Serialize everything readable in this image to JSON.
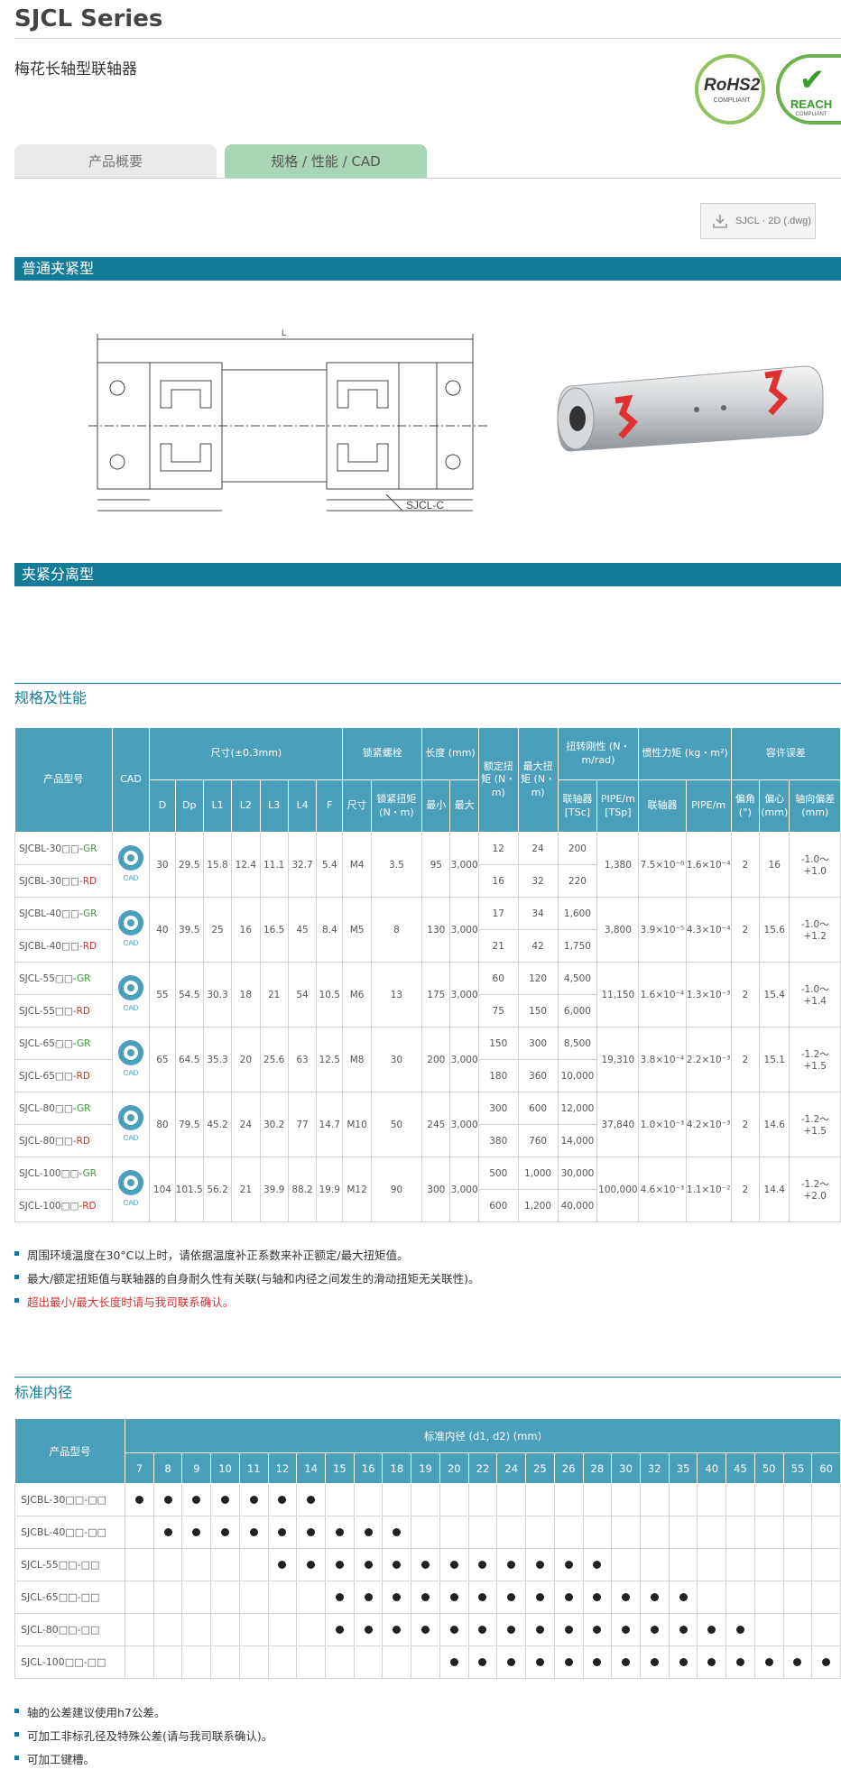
{
  "header": {
    "title": "SJCL Series",
    "subtitle": "梅花长轴型联轴器",
    "badges": {
      "rohs": {
        "main": "RoHS2",
        "sub": "COMPLIANT"
      },
      "reach": {
        "main": "REACH",
        "sub": "COMPLIANT"
      }
    }
  },
  "tabs": [
    {
      "label": "产品概要",
      "active": false
    },
    {
      "label": "规格 / 性能 / CAD",
      "active": true
    }
  ],
  "download": {
    "label": "SJCL · 2D (.dwg)"
  },
  "sections": {
    "clamp": "普通夹紧型",
    "split": "夹紧分离型",
    "spec_title": "规格及性能",
    "bore_title": "标准内径"
  },
  "drawing": {
    "model_label": "SJCL-C"
  },
  "spec_table": {
    "headers": {
      "model": "产品型号",
      "cad": "CAD",
      "dims": "尺寸(±0.3mm)",
      "bolt": "锁紧螺栓",
      "length": "长度 (mm)",
      "rated": "额定扭矩 (N・m)",
      "max_torque": "最大扭矩 (N・m)",
      "stiffness": "扭转刚性 (N・m/rad)",
      "inertia": "惯性力矩 (kg・m²)",
      "tolerance": "容许误差",
      "D": "D",
      "Dp": "Dp",
      "L1": "L1",
      "L2": "L2",
      "L3": "L3",
      "L4": "L4",
      "F": "F",
      "bolt_size": "尺寸",
      "bolt_torque": "锁紧扭矩 (N・m)",
      "len_min": "最小",
      "len_max": "最大",
      "stiff_coupling": "联轴器 [TSc]",
      "stiff_pipe": "PIPE/m [TSp]",
      "inertia_coupling": "联轴器",
      "inertia_pipe": "PIPE/m",
      "angle": "偏角 (°)",
      "offset": "偏心 (mm)",
      "axial": "轴向偏差 (mm)"
    },
    "rows": [
      {
        "m1": "SJCBL-30□□-GR",
        "m2": "SJCBL-30□□-RD",
        "D": "30",
        "Dp": "29.5",
        "L1": "15.8",
        "L2": "12.4",
        "L3": "11.1",
        "L4": "32.7",
        "F": "5.4",
        "bolt": "M4",
        "bt": "3.5",
        "lmin": "95",
        "lmax": "3,000",
        "r1": "12",
        "r2": "16",
        "x1": "24",
        "x2": "32",
        "s1": "200",
        "s2": "220",
        "sp": "1,380",
        "ic": "7.5×10⁻⁶",
        "ip": "1.6×10⁻⁴",
        "ang": "2",
        "off": "16",
        "ax": "-1.0～+1.0"
      },
      {
        "m1": "SJCBL-40□□-GR",
        "m2": "SJCBL-40□□-RD",
        "D": "40",
        "Dp": "39.5",
        "L1": "25",
        "L2": "16",
        "L3": "16.5",
        "L4": "45",
        "F": "8.4",
        "bolt": "M5",
        "bt": "8",
        "lmin": "130",
        "lmax": "3,000",
        "r1": "17",
        "r2": "21",
        "x1": "34",
        "x2": "42",
        "s1": "1,600",
        "s2": "1,750",
        "sp": "3,800",
        "ic": "3.9×10⁻⁵",
        "ip": "4.3×10⁻⁴",
        "ang": "2",
        "off": "15.6",
        "ax": "-1.0～+1.2"
      },
      {
        "m1": "SJCL-55□□-GR",
        "m2": "SJCL-55□□-RD",
        "D": "55",
        "Dp": "54.5",
        "L1": "30.3",
        "L2": "18",
        "L3": "21",
        "L4": "54",
        "F": "10.5",
        "bolt": "M6",
        "bt": "13",
        "lmin": "175",
        "lmax": "3,000",
        "r1": "60",
        "r2": "75",
        "x1": "120",
        "x2": "150",
        "s1": "4,500",
        "s2": "6,000",
        "sp": "11,150",
        "ic": "1.6×10⁻⁴",
        "ip": "1.3×10⁻³",
        "ang": "2",
        "off": "15.4",
        "ax": "-1.0～+1.4"
      },
      {
        "m1": "SJCL-65□□-GR",
        "m2": "SJCL-65□□-RD",
        "D": "65",
        "Dp": "64.5",
        "L1": "35.3",
        "L2": "20",
        "L3": "25.6",
        "L4": "63",
        "F": "12.5",
        "bolt": "M8",
        "bt": "30",
        "lmin": "200",
        "lmax": "3,000",
        "r1": "150",
        "r2": "180",
        "x1": "300",
        "x2": "360",
        "s1": "8,500",
        "s2": "10,000",
        "sp": "19,310",
        "ic": "3.8×10⁻⁴",
        "ip": "2.2×10⁻³",
        "ang": "2",
        "off": "15.1",
        "ax": "-1.2～+1.5"
      },
      {
        "m1": "SJCL-80□□-GR",
        "m2": "SJCL-80□□-RD",
        "D": "80",
        "Dp": "79.5",
        "L1": "45.2",
        "L2": "24",
        "L3": "30.2",
        "L4": "77",
        "F": "14.7",
        "bolt": "M10",
        "bt": "50",
        "lmin": "245",
        "lmax": "3,000",
        "r1": "300",
        "r2": "380",
        "x1": "600",
        "x2": "760",
        "s1": "12,000",
        "s2": "14,000",
        "sp": "37,840",
        "ic": "1.0×10⁻³",
        "ip": "4.2×10⁻³",
        "ang": "2",
        "off": "14.6",
        "ax": "-1.2～+1.5"
      },
      {
        "m1": "SJCL-100□□-GR",
        "m2": "SJCL-100□□-RD",
        "D": "104",
        "Dp": "101.5",
        "L1": "56.2",
        "L2": "21",
        "L3": "39.9",
        "L4": "88.2",
        "F": "19.9",
        "bolt": "M12",
        "bt": "90",
        "lmin": "300",
        "lmax": "3,000",
        "r1": "500",
        "r2": "600",
        "x1": "1,000",
        "x2": "1,200",
        "s1": "30,000",
        "s2": "40,000",
        "sp": "100,000",
        "ic": "4.6×10⁻³",
        "ip": "1.1×10⁻²",
        "ang": "2",
        "off": "14.4",
        "ax": "-1.2～+2.0"
      }
    ]
  },
  "notes1": [
    {
      "text": "周围环境温度在30°C以上时，请依据温度补正系数来补正额定/最大扭矩值。",
      "red": false
    },
    {
      "text": "最大/额定扭矩值与联轴器的自身耐久性有关联(与轴和内径之间发生的滑动扭矩无关联性)。",
      "red": false
    },
    {
      "text": "超出最小/最大长度时请与我司联系确认。",
      "red": true
    }
  ],
  "bore_table": {
    "model_header": "产品型号",
    "group_header": "标准内径 (d1, d2) (mm)",
    "sizes": [
      "7",
      "8",
      "9",
      "10",
      "11",
      "12",
      "14",
      "15",
      "16",
      "18",
      "19",
      "20",
      "22",
      "24",
      "25",
      "26",
      "28",
      "30",
      "32",
      "35",
      "40",
      "45",
      "50",
      "55",
      "60"
    ],
    "rows": [
      {
        "model": "SJCBL-30□□-□□",
        "avail": [
          "7",
          "8",
          "9",
          "10",
          "11",
          "12",
          "14"
        ]
      },
      {
        "model": "SJCBL-40□□-□□",
        "avail": [
          "8",
          "9",
          "10",
          "11",
          "12",
          "14",
          "15",
          "16",
          "18"
        ]
      },
      {
        "model": "SJCL-55□□-□□",
        "avail": [
          "12",
          "14",
          "15",
          "16",
          "18",
          "19",
          "20",
          "22",
          "24",
          "25",
          "26",
          "28"
        ]
      },
      {
        "model": "SJCL-65□□-□□",
        "avail": [
          "15",
          "16",
          "18",
          "19",
          "20",
          "22",
          "24",
          "25",
          "26",
          "28",
          "30",
          "32",
          "35"
        ]
      },
      {
        "model": "SJCL-80□□-□□",
        "avail": [
          "15",
          "16",
          "18",
          "19",
          "20",
          "22",
          "24",
          "25",
          "26",
          "28",
          "30",
          "32",
          "35",
          "40",
          "45"
        ]
      },
      {
        "model": "SJCL-100□□-□□",
        "avail": [
          "20",
          "22",
          "24",
          "25",
          "26",
          "28",
          "30",
          "32",
          "35",
          "40",
          "45",
          "50",
          "55",
          "60"
        ]
      }
    ]
  },
  "notes2": [
    {
      "text": "轴的公差建议使用h7公差。"
    },
    {
      "text": "可加工非标孔径及特殊公差(请与我司联系确认)。"
    },
    {
      "text": "可加工键槽。"
    }
  ],
  "colors": {
    "accent": "#147c98",
    "header_cell": "#4aa0ba",
    "tab_active": "#a8d5b6",
    "green": "#3a9a3a",
    "red": "#d63030"
  }
}
